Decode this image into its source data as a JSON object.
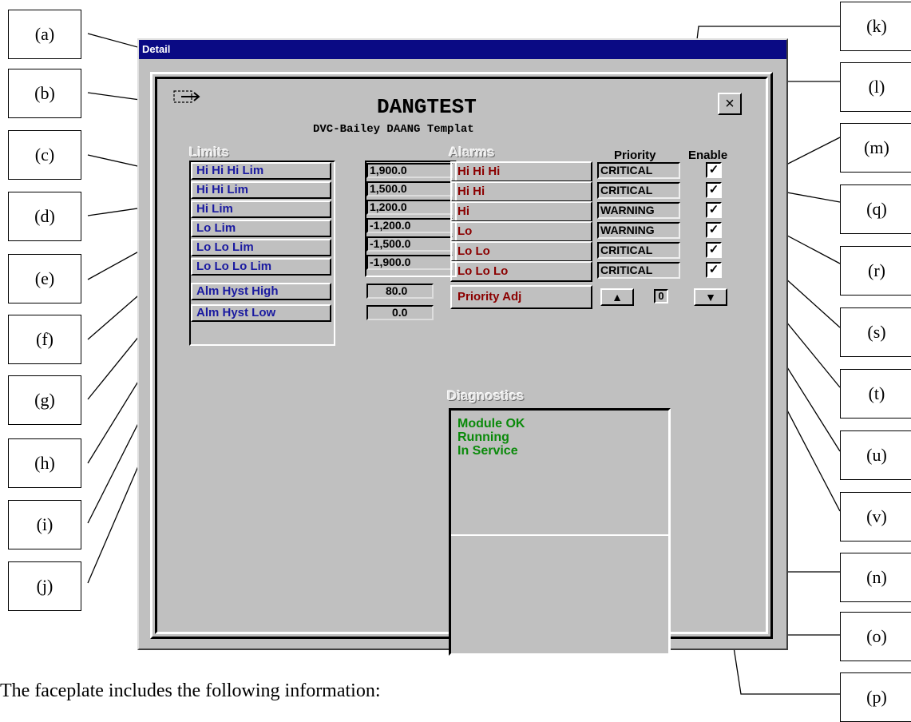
{
  "window": {
    "title": "Detail"
  },
  "faceplate": {
    "module_name": "DANGTEST",
    "description": "DVC-Bailey DAANG Templat",
    "close_glyph": "×",
    "limits": {
      "heading": "Limits",
      "rows": [
        {
          "label": "Hi Hi Hi Lim",
          "value": "1,900.0"
        },
        {
          "label": "Hi Hi Lim",
          "value": "1,500.0"
        },
        {
          "label": "Hi Lim",
          "value": "1,200.0"
        },
        {
          "label": "Lo Lim",
          "value": "-1,200.0"
        },
        {
          "label": "Lo Lo Lim",
          "value": "-1,500.0"
        },
        {
          "label": "Lo Lo Lo Lim",
          "value": "-1,900.0"
        },
        {
          "label": "Alm Hyst High",
          "value": "80.0"
        },
        {
          "label": "Alm Hyst Low",
          "value": "0.0"
        }
      ]
    },
    "alarms": {
      "heading": "Alarms",
      "priority_header": "Priority",
      "enable_header": "Enable",
      "rows": [
        {
          "label": "Hi Hi Hi",
          "priority": "CRITICAL",
          "enabled": "✓"
        },
        {
          "label": "Hi Hi",
          "priority": "CRITICAL",
          "enabled": "✓"
        },
        {
          "label": "Hi",
          "priority": "WARNING",
          "enabled": "✓"
        },
        {
          "label": "Lo",
          "priority": "WARNING",
          "enabled": "✓"
        },
        {
          "label": "Lo Lo",
          "priority": "CRITICAL",
          "enabled": "✓"
        },
        {
          "label": "Lo Lo Lo",
          "priority": "CRITICAL",
          "enabled": "✓"
        }
      ],
      "priority_adj": {
        "label": "Priority Adj",
        "value": "0",
        "up_glyph": "▲",
        "down_glyph": "▼"
      }
    },
    "diagnostics": {
      "heading": "Diagnostics",
      "lines": [
        "Module OK",
        "Running",
        "In Service"
      ]
    }
  },
  "callouts": [
    "(a)",
    "(b)",
    "(c)",
    "(d)",
    "(e)",
    "(f)",
    "(g)",
    "(h)",
    "(i)",
    "(j)",
    "(k)",
    "(l)",
    "(m)",
    "(q)",
    "(r)",
    "(s)",
    "(t)",
    "(u)",
    "(v)",
    "(n)",
    "(o)",
    "(p)"
  ],
  "caption": "The faceplate includes the following information:"
}
